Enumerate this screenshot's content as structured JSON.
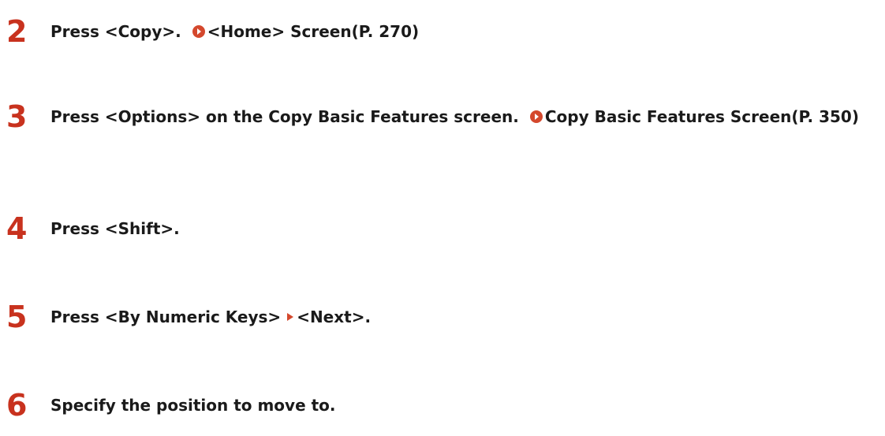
{
  "colors": {
    "step_number": "#c8321e",
    "link_icon": "#d4482d",
    "text": "#1a1a1a"
  },
  "steps": [
    {
      "number": "2",
      "text": "Press <Copy>.",
      "link_text": "<Home> Screen(P. 270)",
      "link_icon": "circle-arrow-right-icon"
    },
    {
      "number": "3",
      "text": "Press <Options> on the Copy Basic Features screen.",
      "link_text": "Copy Basic Features Screen(P. 350)",
      "link_icon": "circle-arrow-right-icon"
    },
    {
      "number": "4",
      "text": "Press <Shift>."
    },
    {
      "number": "5",
      "text_before": "Press <By Numeric Keys>",
      "text_after": "<Next>.",
      "separator_icon": "triangle-right-icon"
    },
    {
      "number": "6",
      "text": "Specify the position to move to."
    }
  ]
}
